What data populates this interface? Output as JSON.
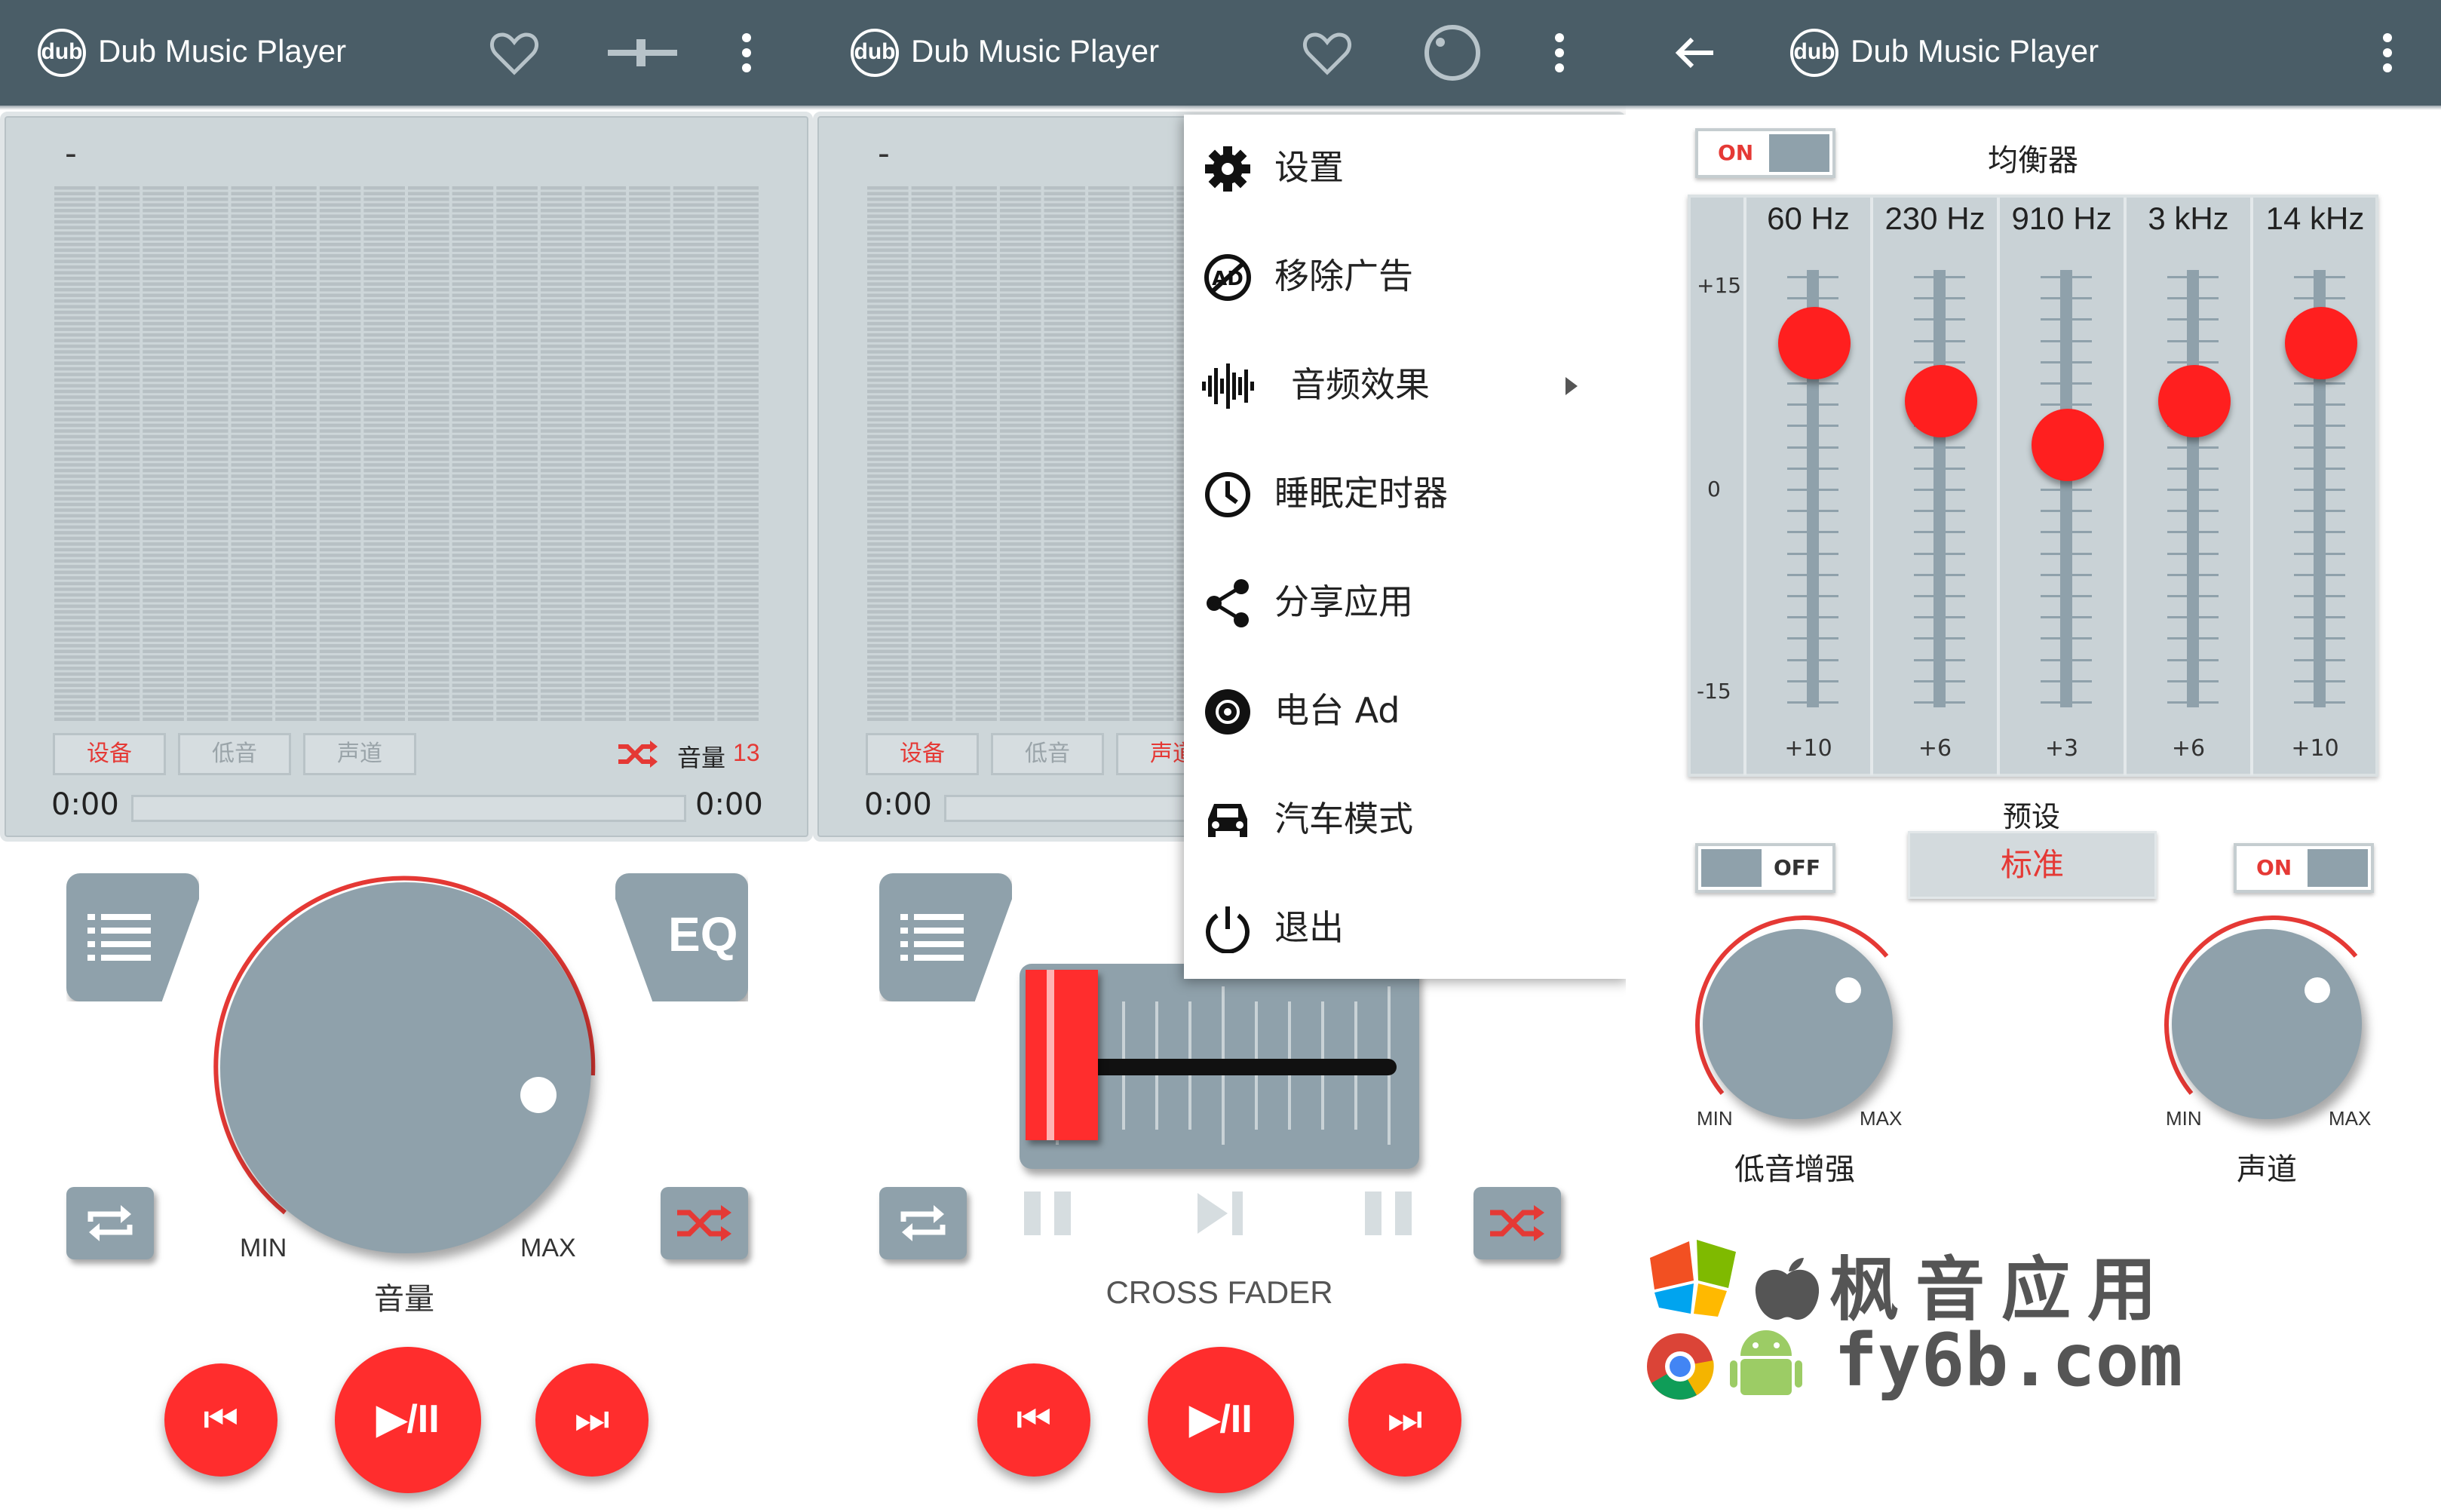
{
  "app": {
    "logo_text": "dub",
    "title": "Dub Music Player"
  },
  "colors": {
    "appbar": "#4a5d67",
    "accent": "#ff2d2d",
    "control": "#8fa1ab",
    "lcd": "#cdd6d9"
  },
  "panel1": {
    "lcd": {
      "track": "-",
      "tabs": [
        "设备",
        "低音",
        "声道"
      ],
      "active_tab": 0,
      "volume_label": "音量",
      "volume_value": "13",
      "time_start": "0:00",
      "time_end": "0:00"
    },
    "playlist_icon": "list-icon",
    "eq_label": "EQ",
    "knob": {
      "min": "MIN",
      "max": "MAX",
      "label": "音量"
    },
    "icons": {
      "header": [
        "heart-icon",
        "slider-icon",
        "more-vert-icon"
      ],
      "repeat": "repeat-icon",
      "shuffle": "shuffle-icon"
    },
    "transport": {
      "prev": "⏮",
      "play": "▶/II",
      "next": "⏭"
    }
  },
  "panel2": {
    "lcd": {
      "track": "-",
      "tabs": [
        "设备",
        "低音",
        "声道"
      ],
      "active_tab": 0,
      "time_start": "0:00"
    },
    "crossfader_label": "CROSS FADER",
    "transport": {
      "prev": "⏮",
      "play": "▶/II",
      "next": "⏭"
    },
    "menu": [
      {
        "icon": "gear-icon",
        "label": "设置"
      },
      {
        "icon": "no-ads-icon",
        "label": "移除广告"
      },
      {
        "icon": "waveform-icon",
        "label": "音频效果",
        "submenu": true
      },
      {
        "icon": "clock-icon",
        "label": "睡眠定时器"
      },
      {
        "icon": "share-icon",
        "label": "分享应用"
      },
      {
        "icon": "radio-disc-icon",
        "label": "电台 Ad"
      },
      {
        "icon": "car-icon",
        "label": "汽车模式"
      },
      {
        "icon": "power-icon",
        "label": "退出"
      }
    ]
  },
  "panel3": {
    "eq_toggle": "ON",
    "eq_title": "均衡器",
    "scale": {
      "top": "+15",
      "mid": "0",
      "bottom": "-15"
    },
    "bands": [
      {
        "hz": "60 Hz",
        "value": "+10",
        "level": 10
      },
      {
        "hz": "230 Hz",
        "value": "+6",
        "level": 6
      },
      {
        "hz": "910 Hz",
        "value": "+3",
        "level": 3
      },
      {
        "hz": "3 kHz",
        "value": "+6",
        "level": 6
      },
      {
        "hz": "14 kHz",
        "value": "+10",
        "level": 10
      }
    ],
    "preset_title": "预设",
    "preset_value": "标准",
    "bass_toggle": "OFF",
    "channel_toggle": "ON",
    "bass_knob": {
      "min": "MIN",
      "max": "MAX",
      "label": "低音增强"
    },
    "channel_knob": {
      "min": "MIN",
      "max": "MAX",
      "label": "声道"
    }
  },
  "watermark": {
    "title": "枫音应用",
    "url": "fy6b.com"
  }
}
